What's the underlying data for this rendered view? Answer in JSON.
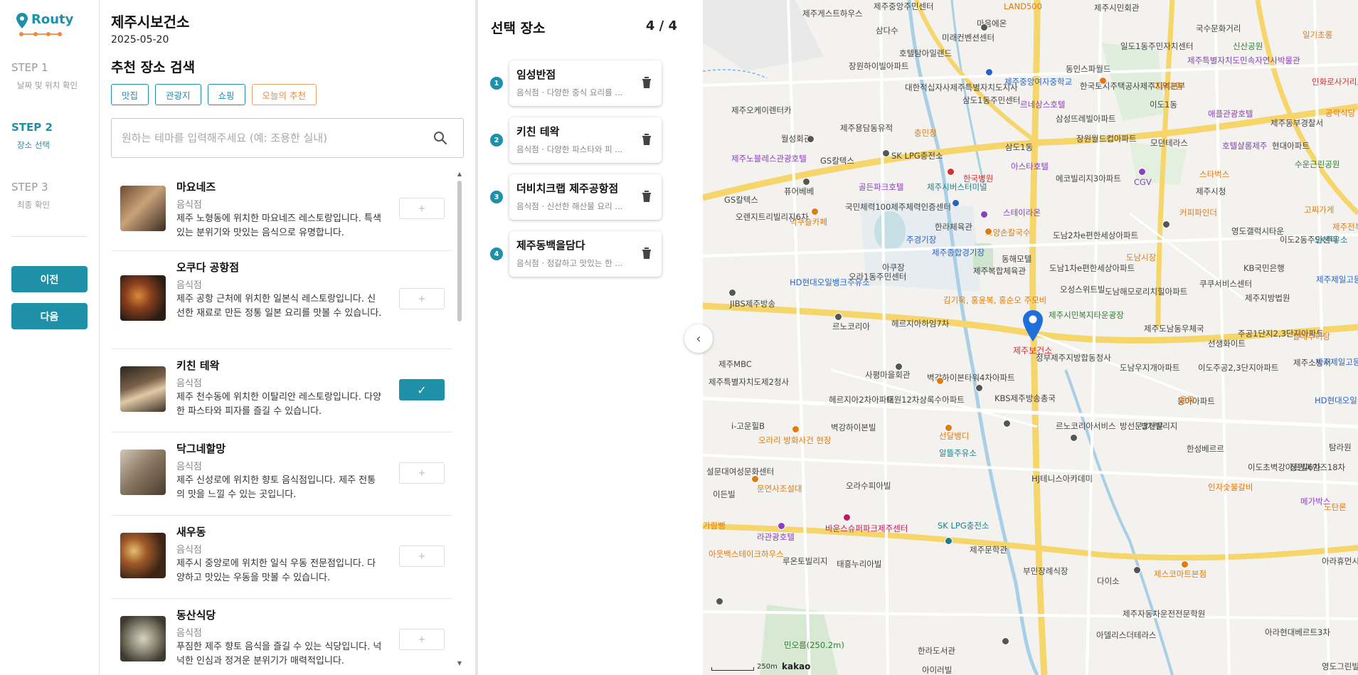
{
  "sidebar": {
    "brand": "Routy",
    "steps": [
      {
        "title": "STEP 1",
        "subtitle": "날짜 및 위치 확인"
      },
      {
        "title": "STEP 2",
        "subtitle": "장소 선택"
      },
      {
        "title": "STEP 3",
        "subtitle": "최종 확인"
      }
    ],
    "prev_label": "이전",
    "next_label": "다음"
  },
  "header": {
    "title": "제주시보건소",
    "date": "2025-05-20",
    "section_title": "추천 장소 검색"
  },
  "categories": [
    "맛집",
    "관광지",
    "쇼핑",
    "오늘의 추천"
  ],
  "search": {
    "placeholder": "원하는 테마를 입력해주세요 (예: 조용한 실내)",
    "value": ""
  },
  "places": [
    {
      "name": "마요네즈",
      "category": "음식점",
      "desc": "제주 노형동에 위치한 마요네즈 레스토랑입니다. 특색있는 분위기와 맛있는 음식으로 유명합니다.",
      "action": "+",
      "selected": false
    },
    {
      "name": "오쿠다 공항점",
      "category": "음식점",
      "desc": "제주 공항 근처에 위치한 일본식 레스토랑입니다. 신선한 재료로 만든 정통 일본 요리를 맛볼 수 있습니다.",
      "action": "+",
      "selected": false
    },
    {
      "name": "키친 테왁",
      "category": "음식점",
      "desc": "제주 천수동에 위치한 이탈리안 레스토랑입니다. 다양한 파스타와 피자를 즐길 수 있습니다.",
      "action": "✓",
      "selected": true
    },
    {
      "name": "닥그네할망",
      "category": "음식점",
      "desc": "제주 신성로에 위치한 향토 음식점입니다. 제주 전통의 맛을 느낄 수 있는 곳입니다.",
      "action": "+",
      "selected": false
    },
    {
      "name": "새우동",
      "category": "음식점",
      "desc": "제주시 중앙로에 위치한 일식 우동 전문점입니다. 다양하고 맛있는 우동을 맛볼 수 있습니다.",
      "action": "+",
      "selected": false
    },
    {
      "name": "동산식당",
      "category": "음식점",
      "desc": "푸짐한 제주 향토 음식을 즐길 수 있는 식당입니다. 넉넉한 인심과 정겨운 분위기가 매력적입니다.",
      "action": "+",
      "selected": false
    }
  ],
  "selected": {
    "title": "선택 장소",
    "count": "4 / 4",
    "items": [
      {
        "num": "1",
        "name": "임성반점",
        "desc": "음식점 · 다양한 중식 요리를 ..."
      },
      {
        "num": "2",
        "name": "키친 테왁",
        "desc": "음식점 · 다양한 파스타와 피 ..."
      },
      {
        "num": "3",
        "name": "더비치크랩 제주공항점",
        "desc": "음식점 · 신선한 해산물 요리 ..."
      },
      {
        "num": "4",
        "name": "제주동백을담다",
        "desc": "음식점 · 정갈하고 맛있는 한 ..."
      }
    ]
  },
  "map": {
    "marker_label": "제주보건소",
    "scale": "250m",
    "provider": "kakao",
    "labels": [
      {
        "t": "제주게스트하우스",
        "c": ""
      },
      {
        "t": "제주중앙주민센터",
        "c": ""
      },
      {
        "t": "LAND500",
        "c": "orange"
      },
      {
        "t": "제주시민회관",
        "c": ""
      },
      {
        "t": "국수문화거리",
        "c": ""
      },
      {
        "t": "일도1동주민자치센터",
        "c": ""
      },
      {
        "t": "신산공원",
        "c": "green"
      },
      {
        "t": "일기초롱",
        "c": "orange"
      },
      {
        "t": "삼다수",
        "c": ""
      },
      {
        "t": "마음에온",
        "c": ""
      },
      {
        "t": "제주특별자치도민속자연사박물관",
        "c": "purple"
      },
      {
        "t": "장원하이빌아파트",
        "c": ""
      },
      {
        "t": "호텔탐아일랜드",
        "c": ""
      },
      {
        "t": "미래컨벤션센터",
        "c": ""
      },
      {
        "t": "동인스파월드",
        "c": ""
      },
      {
        "t": "인화로사거리요양병원",
        "c": "red"
      },
      {
        "t": "대한적십자사제주특별자치도지사",
        "c": ""
      },
      {
        "t": "제주중앙여자중학교",
        "c": "blue"
      },
      {
        "t": "한국토지주택공사제주지역본부",
        "c": ""
      },
      {
        "t": "이도1동",
        "c": ""
      },
      {
        "t": "대유대림",
        "c": "orange"
      },
      {
        "t": "제주오케이렌터카",
        "c": ""
      },
      {
        "t": "삼도1동주민센터",
        "c": ""
      },
      {
        "t": "르네상스호텔",
        "c": "purple"
      },
      {
        "t": "애플관광호텔",
        "c": "purple"
      },
      {
        "t": "제주동부경찰서",
        "c": ""
      },
      {
        "t": "공락식당",
        "c": "orange"
      },
      {
        "t": "제주용담동유적",
        "c": ""
      },
      {
        "t": "충민정",
        "c": "orange"
      },
      {
        "t": "삼성뜨레빌아파트",
        "c": ""
      },
      {
        "t": "호텔샬롬제주",
        "c": "purple"
      },
      {
        "t": "현대아파트",
        "c": ""
      },
      {
        "t": "월성회관",
        "c": ""
      },
      {
        "t": "장원월드컵아파트",
        "c": ""
      },
      {
        "t": "모던테라스",
        "c": ""
      },
      {
        "t": "제주노블레스관광호텔",
        "c": "purple"
      },
      {
        "t": "GS칼텍스",
        "c": ""
      },
      {
        "t": "SK LPG충전소",
        "c": ""
      },
      {
        "t": "삼도1동",
        "c": ""
      },
      {
        "t": "스타벅스",
        "c": "orange"
      },
      {
        "t": "수운근린공원",
        "c": "green"
      },
      {
        "t": "한국병원",
        "c": "red"
      },
      {
        "t": "아스타호텔",
        "c": "purple"
      },
      {
        "t": "CGV",
        "c": "purple"
      },
      {
        "t": "에코빌리지3아파트",
        "c": ""
      },
      {
        "t": "제주시청",
        "c": ""
      },
      {
        "t": "퓨어베베",
        "c": ""
      },
      {
        "t": "골든파크호텔",
        "c": "purple"
      },
      {
        "t": "제주시버스터미널",
        "c": "teal"
      },
      {
        "t": "GS칼텍스",
        "c": ""
      },
      {
        "t": "국민체력100제주체력인증센터",
        "c": ""
      },
      {
        "t": "스테이라온",
        "c": "purple"
      },
      {
        "t": "커피파인더",
        "c": "orange"
      },
      {
        "t": "고찌가게",
        "c": "orange"
      },
      {
        "t": "오렌지트리빌리지6차",
        "c": ""
      },
      {
        "t": "먹쿠슬카페",
        "c": "orange"
      },
      {
        "t": "한라체육관",
        "c": ""
      },
      {
        "t": "오양손칼국수",
        "c": "orange"
      },
      {
        "t": "도남2차e편한세상아파트",
        "c": ""
      },
      {
        "t": "영도갤럭시타운",
        "c": ""
      },
      {
        "t": "이도2동주민센터",
        "c": ""
      },
      {
        "t": "제주전복",
        "c": "orange"
      },
      {
        "t": "SK주유소",
        "c": "teal"
      },
      {
        "t": "주경기장",
        "c": "blue"
      },
      {
        "t": "제주종합경기장",
        "c": "blue"
      },
      {
        "t": "동해모텔",
        "c": ""
      },
      {
        "t": "도남시장",
        "c": "orange"
      },
      {
        "t": "KB국민은행",
        "c": ""
      },
      {
        "t": "아쿠장",
        "c": ""
      },
      {
        "t": "제주복합체육관",
        "c": ""
      },
      {
        "t": "도남1차e편한세상아파트",
        "c": ""
      },
      {
        "t": "제주제일고등학교",
        "c": "blue"
      },
      {
        "t": "HD현대오일뱅크주유소",
        "c": "blue"
      },
      {
        "t": "오라1동주민센터",
        "c": ""
      },
      {
        "t": "오성스위트빌",
        "c": ""
      },
      {
        "t": "도남해모로리치힐아파트",
        "c": ""
      },
      {
        "t": "쿠쿠서비스센터",
        "c": ""
      },
      {
        "t": "제주지방법원",
        "c": ""
      },
      {
        "t": "JIBS제주방송",
        "c": ""
      },
      {
        "t": "김기욱, 홍윤복, 홍순오 주모비",
        "c": "orange"
      },
      {
        "t": "르노코리아",
        "c": ""
      },
      {
        "t": "헤르지아하임7차",
        "c": ""
      },
      {
        "t": "제주시민복지타운광장",
        "c": "green"
      },
      {
        "t": "제주보건소",
        "c": "red"
      },
      {
        "t": "제주도남동우체국",
        "c": ""
      },
      {
        "t": "주공1단지2,3단지아파트",
        "c": ""
      },
      {
        "t": "팔매추어탕",
        "c": "orange"
      },
      {
        "t": "선생화이트",
        "c": ""
      },
      {
        "t": "제주MBC",
        "c": ""
      },
      {
        "t": "사평마을회관",
        "c": ""
      },
      {
        "t": "정부제주지방합동청사",
        "c": ""
      },
      {
        "t": "도남우지개아파트",
        "c": ""
      },
      {
        "t": "이도주공2,3단지아파트",
        "c": ""
      },
      {
        "t": "제주소방서",
        "c": ""
      },
      {
        "t": "제주제일고등학교",
        "c": "blue"
      },
      {
        "t": "제주특별자치도제2청사",
        "c": ""
      },
      {
        "t": "벽강하이본타워4차아파트",
        "c": ""
      },
      {
        "t": "헤르지아2차아파트",
        "c": ""
      },
      {
        "t": "대원12차상록수아파트",
        "c": ""
      },
      {
        "t": "KBS제주방송총국",
        "c": ""
      },
      {
        "t": "동아아파트",
        "c": ""
      },
      {
        "t": "운옥",
        "c": "orange"
      },
      {
        "t": "HD현대오일뱅크주유소",
        "c": "blue"
      },
      {
        "t": "i-고운힐B",
        "c": ""
      },
      {
        "t": "벽강하이본빌",
        "c": ""
      },
      {
        "t": "선달뱅디",
        "c": "orange"
      },
      {
        "t": "르노코리아서비스",
        "c": ""
      },
      {
        "t": "방선문3차빌리지",
        "c": ""
      },
      {
        "t": "탐라원",
        "c": ""
      },
      {
        "t": "오라리 방화사건 현장",
        "c": "orange"
      },
      {
        "t": "알뜰주유소",
        "c": "teal"
      },
      {
        "t": "한성베르르",
        "c": ""
      },
      {
        "t": "이도초벽강아르빌6차",
        "c": ""
      },
      {
        "t": "정원파인즈18차",
        "c": ""
      },
      {
        "t": "설문대여성문화센터",
        "c": ""
      },
      {
        "t": "오라수피아빌",
        "c": ""
      },
      {
        "t": "HJ테니스아카데미",
        "c": ""
      },
      {
        "t": "인자숯불갈비",
        "c": "orange"
      },
      {
        "t": "이든빌",
        "c": ""
      },
      {
        "t": "문연사조설대",
        "c": "orange"
      },
      {
        "t": "메가박스",
        "c": "purple"
      },
      {
        "t": "노탄론",
        "c": "orange"
      },
      {
        "t": "가람뻥",
        "c": "orange"
      },
      {
        "t": "바운스슈퍼파크제주센터",
        "c": "pink"
      },
      {
        "t": "SK LPG충전소",
        "c": "teal"
      },
      {
        "t": "라관광호텔",
        "c": "purple"
      },
      {
        "t": "제주문학관",
        "c": ""
      },
      {
        "t": "아웃백스테이크하우스",
        "c": "orange"
      },
      {
        "t": "루온토빌리지",
        "c": ""
      },
      {
        "t": "태흥누리아빌",
        "c": ""
      },
      {
        "t": "부민장례식장",
        "c": ""
      },
      {
        "t": "다이소",
        "c": ""
      },
      {
        "t": "제스코마트본점",
        "c": "orange"
      },
      {
        "t": "아라휴먼시아",
        "c": ""
      },
      {
        "t": "제주자동차운전전문학원",
        "c": ""
      },
      {
        "t": "아델리스더테라스",
        "c": ""
      },
      {
        "t": "민오름(250.2m)",
        "c": "green"
      },
      {
        "t": "한라도서관",
        "c": ""
      },
      {
        "t": "아라현대베르트3차",
        "c": ""
      },
      {
        "t": "영도그린빌",
        "c": ""
      },
      {
        "t": "방선문",
        "c": ""
      },
      {
        "t": "아이러빌",
        "c": ""
      }
    ]
  },
  "colors": {
    "accent": "#1e90a8",
    "special": "#f08a40"
  }
}
